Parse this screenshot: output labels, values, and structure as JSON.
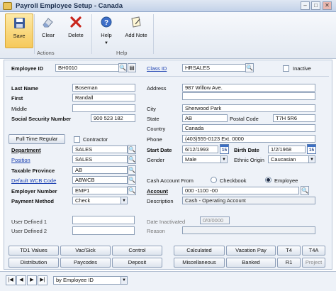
{
  "window": {
    "title": "Payroll Employee Setup - Canada",
    "min": "–",
    "max": "□",
    "close": "✕"
  },
  "ribbon": {
    "save": "Save",
    "clear": "Clear",
    "delete": "Delete",
    "help": "Help",
    "add_note": "Add Note",
    "group_actions": "Actions",
    "group_help": "Help"
  },
  "employee": {
    "id_label": "Employee ID",
    "id": "BH0010",
    "class_label": "Class ID",
    "class_id": "HRSALES",
    "inactive_label": "Inactive",
    "last_label": "Last Name",
    "last": "Boseman",
    "first_label": "First",
    "first": "Randall",
    "middle_label": "Middle",
    "middle": "",
    "ssn_label": "Social Security Number",
    "ssn": "900 523 182",
    "address_label": "Address",
    "address1": "987 Willow Ave.",
    "address2": "",
    "address3": "",
    "city_label": "City",
    "city": "Sherwood Park",
    "state_label": "State",
    "state": "AB",
    "postal_label": "Postal Code",
    "postal": "T7H 5R6",
    "country_label": "Country",
    "country": "Canada",
    "phone_label": "Phone",
    "phone": "(403)555-0123 Ext. 0000",
    "status_button": "Full Time Regular",
    "contractor_label": "Contractor",
    "start_label": "Start Date",
    "start": "6/12/1993",
    "birth_label": "Birth Date",
    "birth": "1/2/1968",
    "dept_label": "Department",
    "dept": "SALES",
    "position_label": "Position",
    "position": "SALES",
    "gender_label": "Gender",
    "gender": "Male",
    "ethnic_label": "Ethnic Origin",
    "ethnic": "Caucasian",
    "province_label": "Taxable Province",
    "province": "AB",
    "wcb_label": "Default WCB Code",
    "wcb": "ABWCB",
    "cash_from_label": "Cash Account From",
    "cash_opt1": "Checkbook",
    "cash_opt2": "Employee",
    "employer_label": "Employer Number",
    "employer": "EMP1",
    "account_label": "Account",
    "account": "000 -1100 -00",
    "payment_label": "Payment Method",
    "payment": "Check",
    "desc_label": "Description",
    "desc": "Cash - Operating Account",
    "ud1_label": "User Defined 1",
    "ud1": "",
    "ud2_label": "User Defined 2",
    "ud2": "",
    "inactivated_label": "Date Inactivated",
    "inactivated": "0/0/0000",
    "reason_label": "Reason",
    "reason": "",
    "cal_day": "15"
  },
  "buttons": {
    "td1": "TD1 Values",
    "vac": "Vac/Sick",
    "control": "Control",
    "calculated": "Calculated",
    "vacation_pay": "Vacation Pay",
    "t4": "T4",
    "t4a": "T4A",
    "distribution": "Distribution",
    "paycodes": "Paycodes",
    "deposit": "Deposit",
    "misc": "Miscellaneous",
    "banked": "Banked",
    "r1": "R1",
    "project": "Project"
  },
  "statusbar": {
    "sort": "by Employee ID",
    "first": "|◀",
    "prev": "◀",
    "next": "▶",
    "last": "▶|"
  },
  "colors": {
    "accent": "#1a3fb0",
    "ribbon": "#e3e9f2",
    "form": "#eef2f8"
  }
}
